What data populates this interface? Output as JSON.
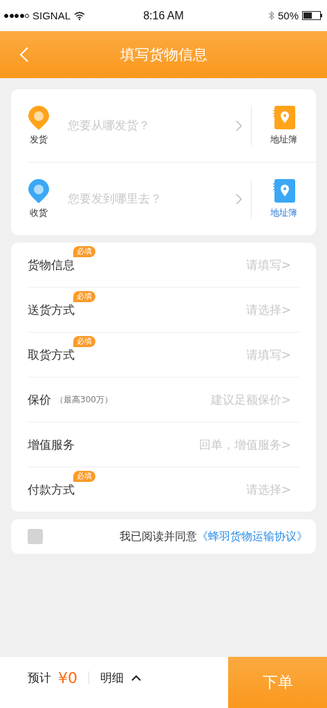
{
  "status_bar": {
    "carrier": "SIGNAL",
    "time": "8:16 AM",
    "battery": "50%"
  },
  "header": {
    "title": "填写货物信息"
  },
  "addresses": [
    {
      "label": "发货",
      "placeholder": "您要从哪发货？",
      "book_label": "地址簿",
      "color": "#ffa31a",
      "selected": false
    },
    {
      "label": "收货",
      "placeholder": "您要发到哪里去？",
      "book_label": "地址簿",
      "color": "#3aa8f5",
      "selected": true
    }
  ],
  "form_rows": [
    {
      "label": "货物信息",
      "required": true,
      "required_badge": "必填",
      "hint": "请填写>"
    },
    {
      "label": "送货方式",
      "required": true,
      "required_badge": "必填",
      "hint": "请选择>"
    },
    {
      "label": "取货方式",
      "required": true,
      "required_badge": "必填",
      "hint": "请填写>"
    },
    {
      "label": "保价",
      "note": "（最高300万）",
      "required": false,
      "hint": "建议足额保价>"
    },
    {
      "label": "增值服务",
      "required": false,
      "hint": "回单，增值服务>"
    },
    {
      "label": "付款方式",
      "required": true,
      "required_badge": "必填",
      "hint": "请选择>"
    }
  ],
  "agreement": {
    "checked": false,
    "text": "我已阅读并同意",
    "link": "《蜂羽货物运输协议》"
  },
  "bottom_bar": {
    "estimate_label": "预计",
    "price": "¥0",
    "details": "明细",
    "submit": "下单"
  }
}
